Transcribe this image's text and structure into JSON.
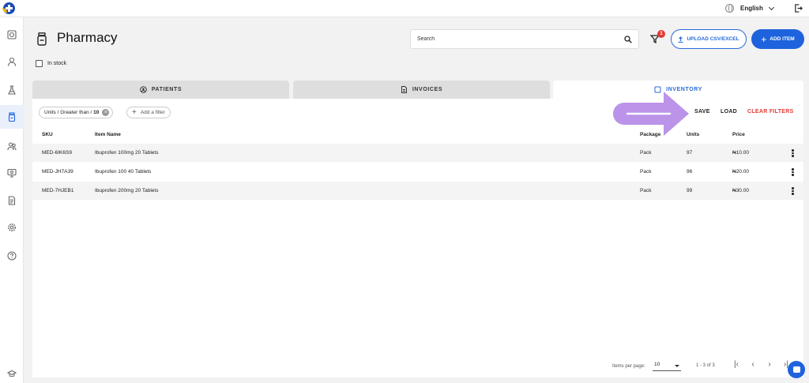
{
  "header": {
    "language": "English",
    "title": "Pharmacy",
    "search_placeholder": "Search",
    "filter_count": "1",
    "upload_label": "UPLOAD CSV/EXCEL",
    "add_item_label": "ADD ITEM"
  },
  "sidebar": {
    "items": [
      {
        "icon": "dashboard-icon"
      },
      {
        "icon": "user-icon"
      },
      {
        "icon": "lab-icon"
      },
      {
        "icon": "pharmacy-icon",
        "active": true
      },
      {
        "icon": "staff-icon"
      },
      {
        "icon": "monitor-icon"
      },
      {
        "icon": "document-icon"
      },
      {
        "icon": "gear-icon"
      },
      {
        "icon": "help-icon"
      },
      {
        "icon": "graduation-cap-icon"
      }
    ]
  },
  "filters": {
    "in_stock_label": "In stock",
    "chip_prefix": "Units / Greater than / ",
    "chip_value": "10",
    "add_filter_label": "Add a filter",
    "save_label": "SAVE",
    "load_label": "LOAD",
    "clear_label": "CLEAR FILTERS"
  },
  "tabs": [
    {
      "label": "PATIENTS",
      "icon": "patient-icon",
      "active": false
    },
    {
      "label": "INVOICES",
      "icon": "invoice-icon",
      "active": false
    },
    {
      "label": "INVENTORY",
      "icon": "inventory-icon",
      "active": true
    }
  ],
  "table": {
    "columns": [
      "SKU",
      "Item Name",
      "Package",
      "Units",
      "Price"
    ],
    "rows": [
      {
        "sku": "MED-6IK6S9",
        "name": "Ibuprofen 100mg 20 Tablets",
        "package": "Pack",
        "units": "97",
        "price": "₦10.00"
      },
      {
        "sku": "MED-JH7A39",
        "name": "Ibuprofen 100 40 Tablets",
        "package": "Pack",
        "units": "96",
        "price": "₦20.00"
      },
      {
        "sku": "MED-7HJEB1",
        "name": "Ibuprofen 200mg 20 Tablets",
        "package": "Pack",
        "units": "99",
        "price": "₦30.00"
      }
    ]
  },
  "pagination": {
    "items_per_page_label": "Items per page:",
    "items_per_page": "10",
    "range": "1 - 3 of 3"
  },
  "colors": {
    "accent": "#1e63dd",
    "danger": "#e53935",
    "annotation_arrow": "#b58ae6"
  }
}
